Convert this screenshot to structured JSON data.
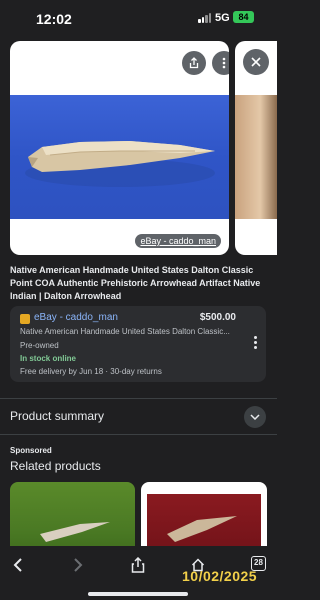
{
  "status_bar": {
    "time": "12:02",
    "network": "5G",
    "battery": "84"
  },
  "image_viewer": {
    "source_badge": "eBay - caddo_man",
    "icons": [
      "share-icon",
      "more-vert-icon",
      "close-icon"
    ]
  },
  "listing": {
    "title": "Native American Handmade United States Dalton Classic Point COA Authentic Prehistoric Arrowhead Artifact Native Indian | Dalton Arrowhead"
  },
  "offer": {
    "seller": "eBay - caddo_man",
    "price": "$500.00",
    "description": "Native American Handmade United States Dalton Classic...",
    "condition": "Pre-owned",
    "stock": "In stock online",
    "delivery": "Free delivery by Jun 18 · 30-day returns"
  },
  "sections": {
    "product_summary": "Product summary",
    "sponsored": "Sponsored",
    "related_products": "Related products"
  },
  "toolbar": {
    "tab_count": "28"
  },
  "overlay": {
    "date_stamp": "10/02/2025"
  },
  "colors": {
    "background": "#1f1f21",
    "link": "#8ab4f8",
    "in_stock": "#81c995",
    "date_stamp": "#f2d04a"
  }
}
